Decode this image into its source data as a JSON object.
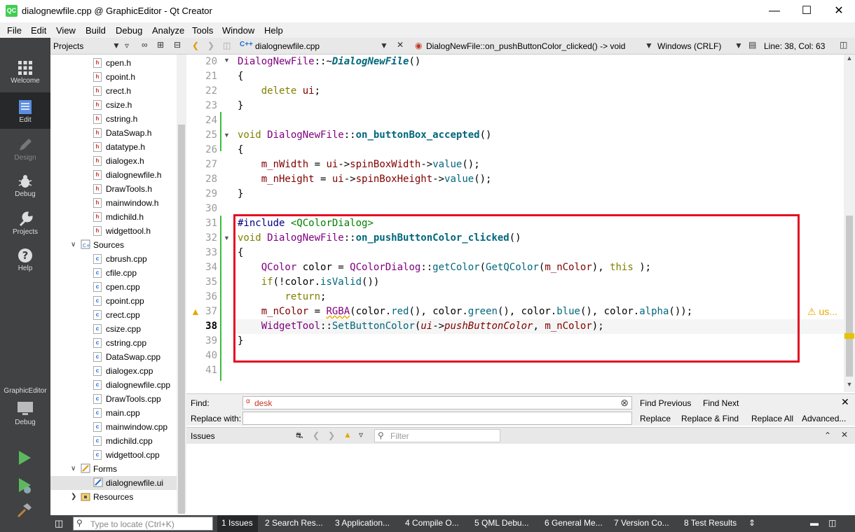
{
  "window": {
    "title": "dialognewfile.cpp @ GraphicEditor - Qt Creator",
    "app_icon": "QC"
  },
  "menu": [
    "File",
    "Edit",
    "View",
    "Build",
    "Debug",
    "Analyze",
    "Tools",
    "Window",
    "Help"
  ],
  "modes": [
    {
      "label": "Welcome",
      "icon": "grid-icon"
    },
    {
      "label": "Edit",
      "icon": "document-icon"
    },
    {
      "label": "Design",
      "icon": "pencil-icon"
    },
    {
      "label": "Debug",
      "icon": "bug-icon"
    },
    {
      "label": "Projects",
      "icon": "wrench-icon"
    },
    {
      "label": "Help",
      "icon": "question-icon"
    }
  ],
  "kit": {
    "project": "GraphicEditor",
    "mode": "Debug"
  },
  "projects_panel": {
    "title": "Projects"
  },
  "tree": {
    "headers_files": [
      "cpen.h",
      "cpoint.h",
      "crect.h",
      "csize.h",
      "cstring.h",
      "DataSwap.h",
      "datatype.h",
      "dialogex.h",
      "dialognewfile.h",
      "DrawTools.h",
      "mainwindow.h",
      "mdichild.h",
      "widgettool.h"
    ],
    "sources_label": "Sources",
    "sources_files": [
      "cbrush.cpp",
      "cfile.cpp",
      "cpen.cpp",
      "cpoint.cpp",
      "crect.cpp",
      "csize.cpp",
      "cstring.cpp",
      "DataSwap.cpp",
      "dialogex.cpp",
      "dialognewfile.cpp",
      "DrawTools.cpp",
      "main.cpp",
      "mainwindow.cpp",
      "mdichild.cpp",
      "widgettool.cpp"
    ],
    "forms_label": "Forms",
    "forms_files": [
      "dialognewfile.ui"
    ],
    "resources_label": "Resources"
  },
  "editor": {
    "file_tab": "dialognewfile.cpp",
    "symbol": "DialogNewFile::on_pushButtonColor_clicked() -> void",
    "line_ending": "Windows (CRLF)",
    "position": "Line: 38, Col: 63",
    "line_numbers": [
      "20",
      "21",
      "22",
      "23",
      "24",
      "25",
      "26",
      "27",
      "28",
      "29",
      "30",
      "31",
      "32",
      "33",
      "34",
      "35",
      "36",
      "37",
      "38",
      "39",
      "40",
      "41"
    ],
    "warning_text": "⚠ us..."
  },
  "find": {
    "find_label": "Find:",
    "find_value": "desk",
    "replace_label": "Replace with:",
    "find_previous": "Find Previous",
    "find_next": "Find Next",
    "replace": "Replace",
    "replace_find": "Replace & Find",
    "replace_all": "Replace All",
    "advanced": "Advanced..."
  },
  "issues": {
    "title": "Issues",
    "filter_placeholder": "Filter"
  },
  "status": {
    "locate_placeholder": "Type to locate (Ctrl+K)",
    "tabs": [
      "1  Issues",
      "2  Search Res...",
      "3  Application...",
      "4  Compile O...",
      "5  QML Debu...",
      "6  General Me...",
      "7  Version Co...",
      "8  Test Results"
    ]
  },
  "colors": {
    "highlight": "#e30d22",
    "modebar": "#404244"
  }
}
